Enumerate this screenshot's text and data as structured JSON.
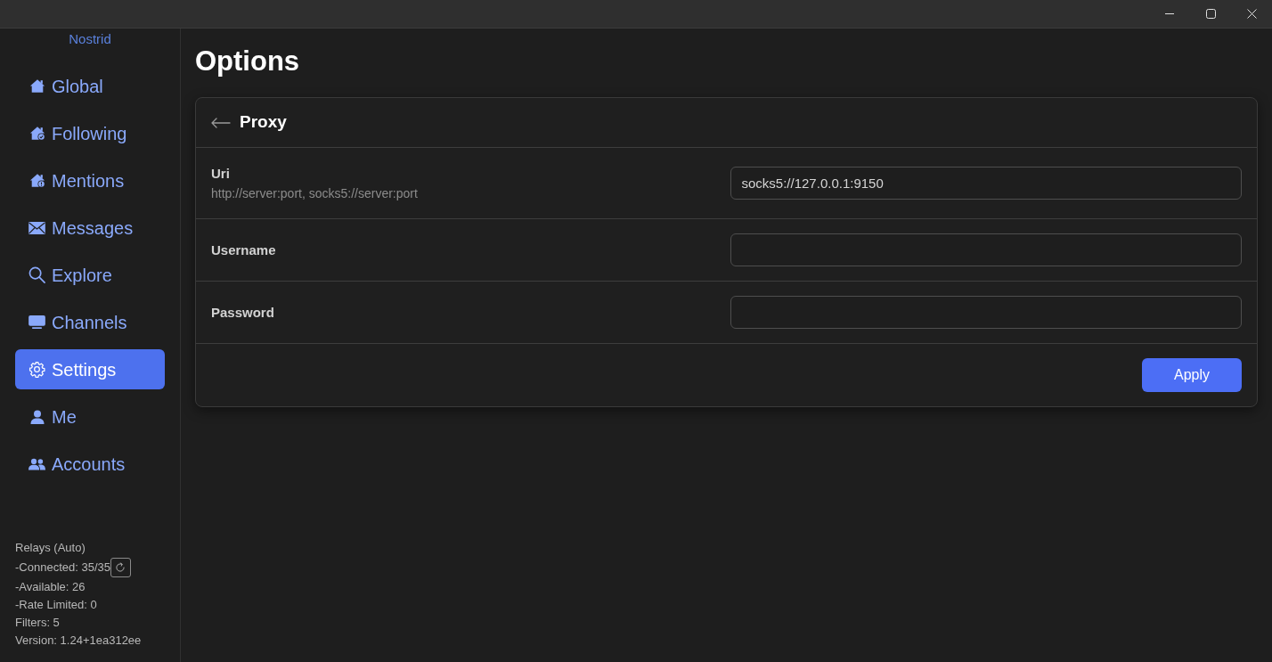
{
  "sidebar": {
    "app_name": "Nostrid",
    "items": [
      {
        "label": "Global",
        "selected": false
      },
      {
        "label": "Following",
        "selected": false
      },
      {
        "label": "Mentions",
        "selected": false
      },
      {
        "label": "Messages",
        "selected": false
      },
      {
        "label": "Explore",
        "selected": false
      },
      {
        "label": "Channels",
        "selected": false
      },
      {
        "label": "Settings",
        "selected": true
      },
      {
        "label": "Me",
        "selected": false
      },
      {
        "label": "Accounts",
        "selected": false
      }
    ],
    "status_lines": [
      {
        "text": "Relays (Auto)",
        "kind": "plain"
      },
      {
        "text": "-Connected: 35/35",
        "kind": "reload"
      },
      {
        "text": "-Available: 26",
        "kind": "plain"
      },
      {
        "text": "-Rate Limited: 0",
        "kind": "plain"
      },
      {
        "text": "Filters: 5",
        "kind": "plain"
      },
      {
        "text": "Version: 1.24+1ea312ee",
        "kind": "plain"
      }
    ]
  },
  "page_title": "Options",
  "card": {
    "title": "Proxy",
    "fields": [
      {
        "label": "Uri",
        "description": "http://server:port, socks5://server:port",
        "value": "socks5://127.0.0.1:9150"
      },
      {
        "label": "Username"
      },
      {
        "label": "Password"
      }
    ],
    "button": "Apply"
  }
}
